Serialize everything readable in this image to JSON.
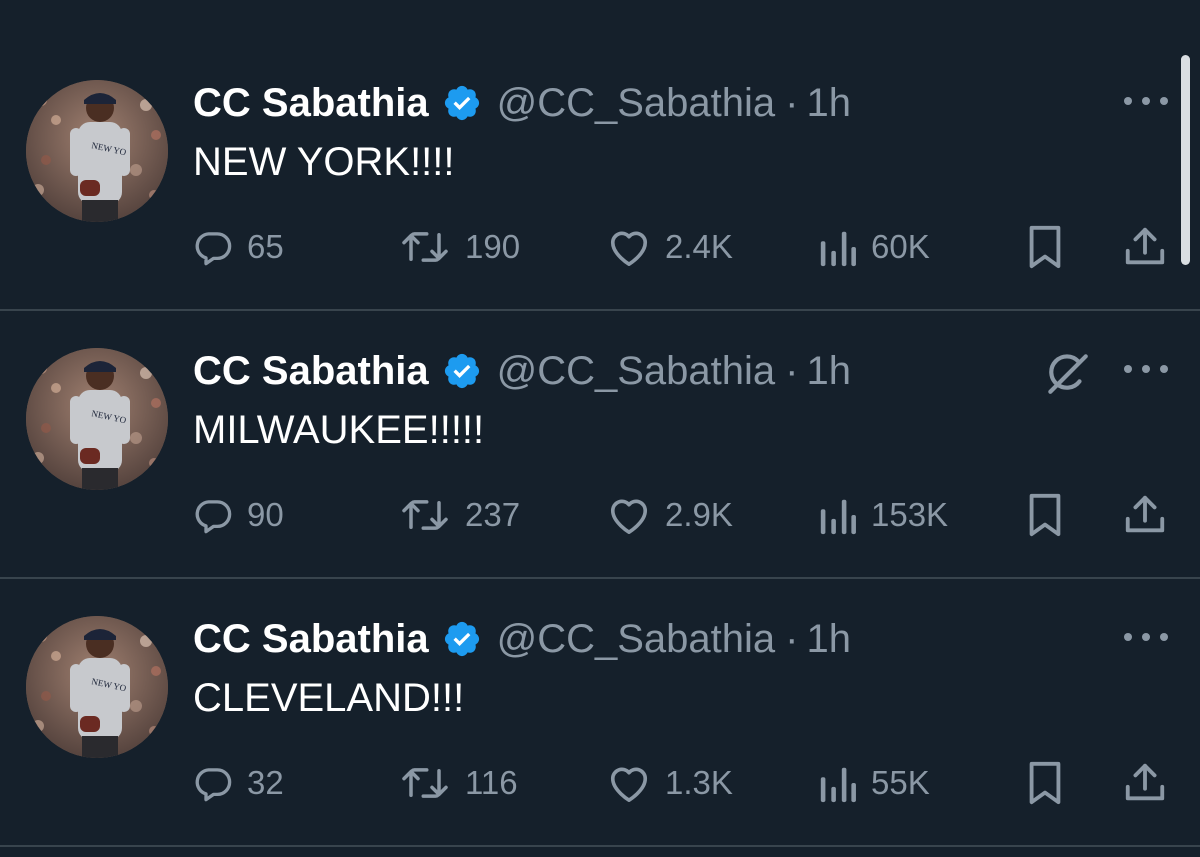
{
  "colors": {
    "background": "#15202b",
    "divider": "#38444d",
    "text_primary": "#ffffff",
    "text_secondary": "#8b98a5",
    "verified_badge": "#1d9bf0"
  },
  "icons": {
    "reply": "speech-bubble",
    "retweet": "repost-arrows",
    "like": "heart",
    "views": "bar-chart",
    "bookmark": "bookmark",
    "share": "share-upload",
    "more": "three-dots",
    "verified": "verified-badge",
    "grok": "grok-slash-circle"
  },
  "tweets": [
    {
      "display_name": "CC Sabathia",
      "handle": "@CC_Sabathia",
      "separator": "·",
      "time": "1h",
      "text": "NEW YORK!!!!",
      "replies": "65",
      "retweets": "190",
      "likes": "2.4K",
      "views": "60K"
    },
    {
      "display_name": "CC Sabathia",
      "handle": "@CC_Sabathia",
      "separator": "·",
      "time": "1h",
      "text": "MILWAUKEE!!!!!",
      "replies": "90",
      "retweets": "237",
      "likes": "2.9K",
      "views": "153K"
    },
    {
      "display_name": "CC Sabathia",
      "handle": "@CC_Sabathia",
      "separator": "·",
      "time": "1h",
      "text": "CLEVELAND!!!",
      "replies": "32",
      "retweets": "116",
      "likes": "1.3K",
      "views": "55K"
    }
  ]
}
